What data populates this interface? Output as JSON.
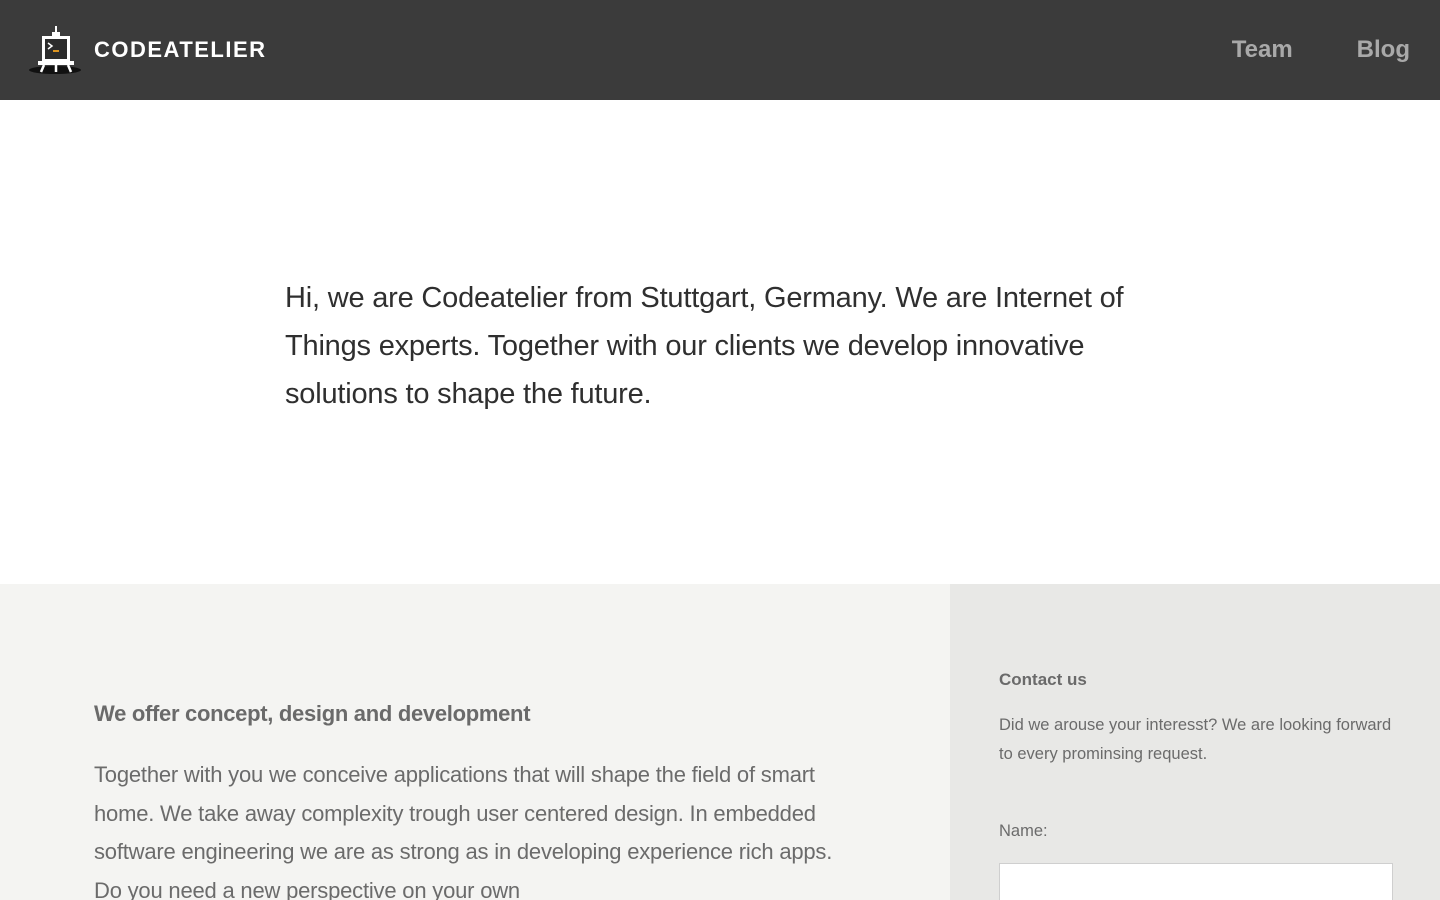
{
  "header": {
    "brand": "CODEATELIER",
    "nav": [
      {
        "label": "Team"
      },
      {
        "label": "Blog"
      }
    ]
  },
  "hero": {
    "text": "Hi, we are Codeatelier from Stuttgart, Germany. We are Internet of Things experts. Together with our clients we develop innovative solutions to shape the future."
  },
  "services": {
    "title": "We offer concept, design and development",
    "body": "Together with you we conceive applications that will shape the field of smart home. We take away complexity trough user centered design. In embedded software engineering we are as strong as in developing experience rich apps. Do you need a new perspective on your own"
  },
  "contact": {
    "title": "Contact us",
    "intro": "Did we arouse your interesst? We are looking forward to every prominsing request.",
    "name_label": "Name:",
    "name_value": "",
    "name_placeholder": ""
  },
  "colors": {
    "header_bg": "#3b3b3b",
    "nav_text": "#a9a9a9",
    "services_bg": "#f4f4f2",
    "contact_bg": "#e8e8e6",
    "logo_accent": "#f0a020"
  },
  "icons": {
    "logo": "easel-terminal-icon"
  }
}
